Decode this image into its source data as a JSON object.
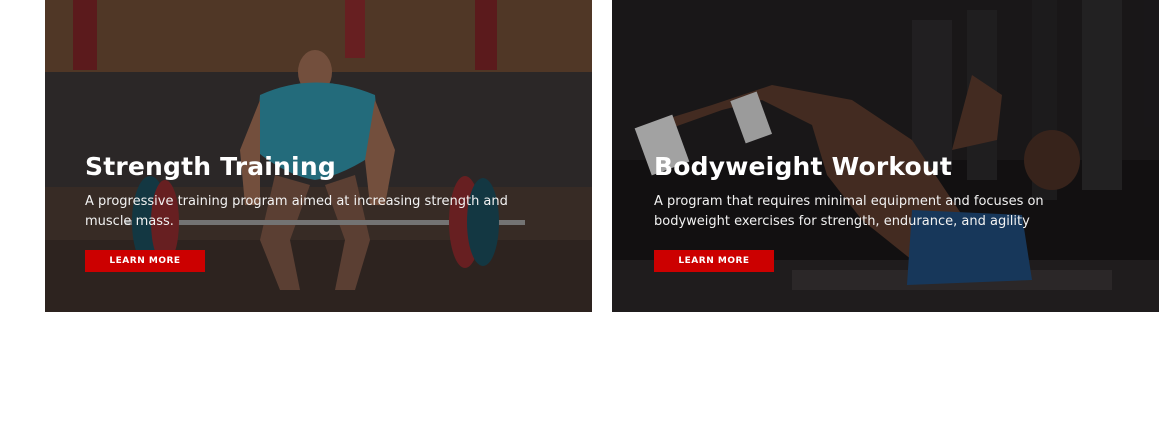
{
  "cards": [
    {
      "title": "Strength Training",
      "description": "A progressive training program aimed at increasing strength and muscle mass.",
      "button_label": "LEARN MORE",
      "image_icon": "weightlifter-deadlift-photo"
    },
    {
      "title": "Bodyweight Workout",
      "description": "A program that requires minimal equipment and focuses on bodyweight exercises for strength, endurance, and agility",
      "button_label": "LEARN MORE",
      "image_icon": "crunch-exercise-photo"
    }
  ],
  "colors": {
    "button_bg": "#cc0000",
    "text": "#ffffff",
    "page_bg": "#ffffff"
  }
}
